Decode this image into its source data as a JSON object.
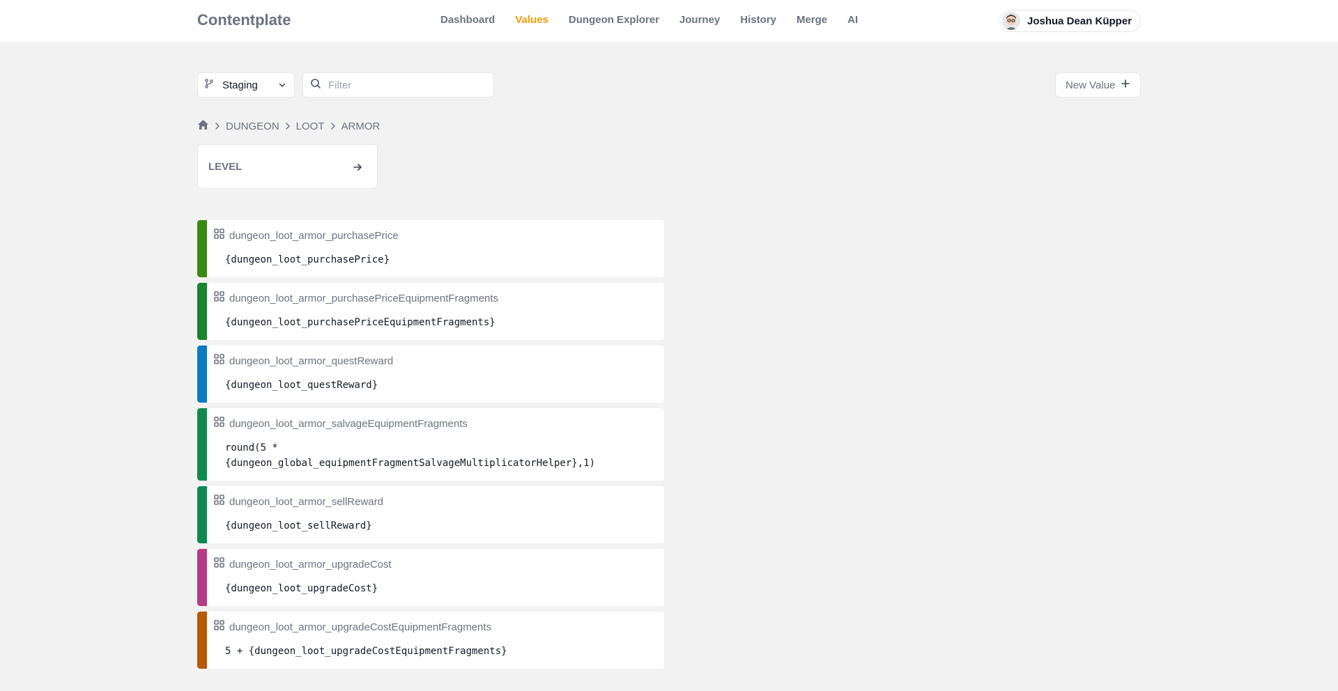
{
  "app": {
    "brand": "Contentplate"
  },
  "nav": {
    "items": [
      {
        "label": "Dashboard"
      },
      {
        "label": "Values"
      },
      {
        "label": "Dungeon Explorer"
      },
      {
        "label": "Journey"
      },
      {
        "label": "History"
      },
      {
        "label": "Merge"
      },
      {
        "label": "AI"
      }
    ],
    "active": "Values"
  },
  "user": {
    "name": "Joshua Dean Küpper"
  },
  "toolbar": {
    "branch": "Staging",
    "filter_placeholder": "Filter",
    "new_value_label": "New Value"
  },
  "breadcrumb": {
    "items": [
      "DUNGEON",
      "LOOT",
      "ARMOR"
    ]
  },
  "level_card": {
    "title": "LEVEL"
  },
  "values": [
    {
      "name": "dungeon_loot_armor_purchasePrice",
      "expr": "{dungeon_loot_purchasePrice}",
      "color": "#3a8a12"
    },
    {
      "name": "dungeon_loot_armor_purchasePriceEquipmentFragments",
      "expr": "{dungeon_loot_purchasePriceEquipmentFragments}",
      "color": "#17862a"
    },
    {
      "name": "dungeon_loot_armor_questReward",
      "expr": "{dungeon_loot_questReward}",
      "color": "#0a7bc2"
    },
    {
      "name": "dungeon_loot_armor_salvageEquipmentFragments",
      "expr": "round(5 *\n{dungeon_global_equipmentFragmentSalvageMultiplicatorHelper},1)",
      "color": "#0e8a4e"
    },
    {
      "name": "dungeon_loot_armor_sellReward",
      "expr": "{dungeon_loot_sellReward}",
      "color": "#0d8a50"
    },
    {
      "name": "dungeon_loot_armor_upgradeCost",
      "expr": "{dungeon_loot_upgradeCost}",
      "color": "#b73a85"
    },
    {
      "name": "dungeon_loot_armor_upgradeCostEquipmentFragments",
      "expr": "5 + {dungeon_loot_upgradeCostEquipmentFragments}",
      "color": "#b55a07"
    }
  ]
}
